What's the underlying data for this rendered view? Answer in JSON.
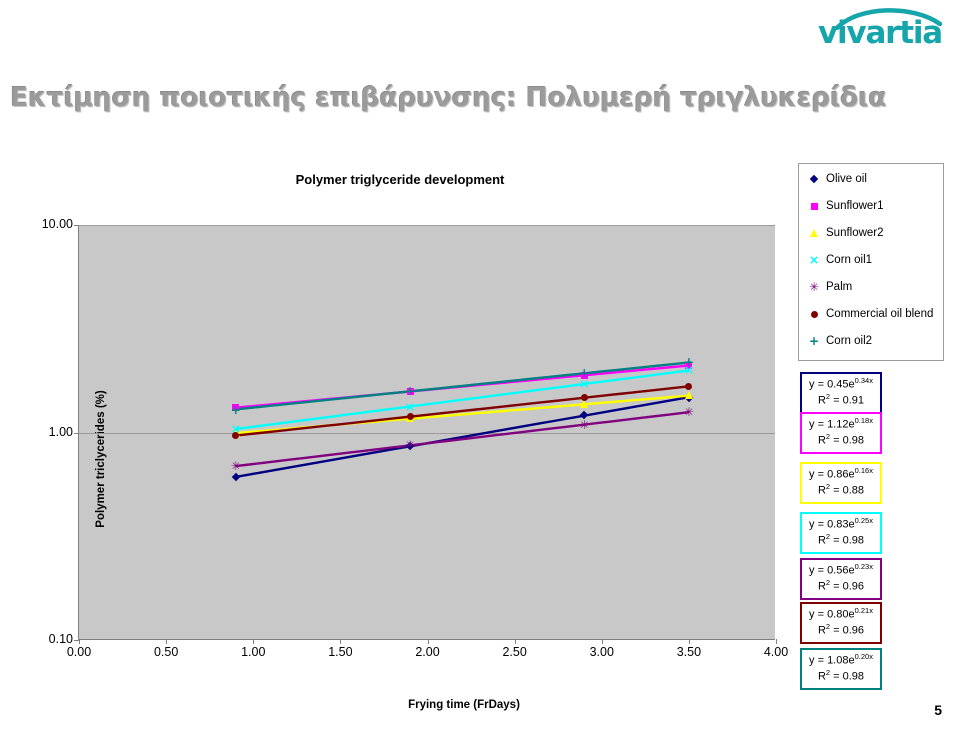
{
  "logo": {
    "text": "vivartia",
    "color": "#15a5ab"
  },
  "slide": {
    "title": "Εκτίμηση ποιοτικής επιβάρυνσης: Πολυμερή τριγλυκερίδια",
    "page_number": "5"
  },
  "chart_data": {
    "type": "scatter",
    "title": "Polymer triglyceride development",
    "xlabel": "Frying time (FrDays)",
    "ylabel": "Polymer triclycerides (%)",
    "xlim": [
      0.0,
      4.0
    ],
    "ylim": [
      0.1,
      10.0
    ],
    "yscale": "log",
    "grid": true,
    "legend_position": "right",
    "xticks": [
      "0.00",
      "0.50",
      "1.00",
      "1.50",
      "2.00",
      "2.50",
      "3.00",
      "3.50",
      "4.00"
    ],
    "xtick_values": [
      0.0,
      0.5,
      1.0,
      1.5,
      2.0,
      2.5,
      3.0,
      3.5,
      4.0
    ],
    "yticks": [
      "0.10",
      "1.00",
      "10.00"
    ],
    "ytick_values": [
      0.1,
      1.0,
      10.0
    ],
    "series": [
      {
        "name": "Olive oil",
        "color": "#000080",
        "marker": "diamond",
        "equation": "y = 0.45e",
        "exponent": "0.34x",
        "r2": "R",
        "r2_value": " = 0.91",
        "a": 0.45,
        "b": 0.34,
        "r_squared": 0.91,
        "x": [
          0.9,
          1.9,
          2.9,
          3.5
        ],
        "y": [
          0.61,
          0.86,
          1.21,
          1.47
        ]
      },
      {
        "name": "Sunflower1",
        "color": "#ff00ff",
        "marker": "square",
        "equation": "y = 1.12e",
        "exponent": "0.18x",
        "r2": "R",
        "r2_value": " = 0.98",
        "a": 1.12,
        "b": 0.18,
        "r_squared": 0.98,
        "x": [
          0.9,
          1.9,
          2.9,
          3.5
        ],
        "y": [
          1.32,
          1.58,
          1.89,
          2.1
        ]
      },
      {
        "name": "Sunflower2",
        "color": "#ffff00",
        "marker": "triangle",
        "equation": "y = 0.86e",
        "exponent": "0.16x",
        "r2": "R",
        "r2_value": " = 0.88",
        "a": 0.86,
        "b": 0.16,
        "r_squared": 0.88,
        "x": [
          0.9,
          1.9,
          2.9,
          3.5
        ],
        "y": [
          0.99,
          1.17,
          1.37,
          1.51
        ]
      },
      {
        "name": "Corn oil1",
        "color": "#00ffff",
        "marker": "cross",
        "equation": "y = 0.83e",
        "exponent": "0.25x",
        "r2": "R",
        "r2_value": " = 0.98",
        "a": 0.83,
        "b": 0.25,
        "r_squared": 0.98,
        "x": [
          0.9,
          1.9,
          2.9,
          3.5
        ],
        "y": [
          1.04,
          1.33,
          1.71,
          1.99
        ]
      },
      {
        "name": "Palm",
        "color": "#800080",
        "marker": "star",
        "equation": "y = 0.56e",
        "exponent": "0.23x",
        "r2": "R",
        "r2_value": " = 0.96",
        "a": 0.56,
        "b": 0.23,
        "r_squared": 0.96,
        "x": [
          0.9,
          1.9,
          2.9,
          3.5
        ],
        "y": [
          0.69,
          0.87,
          1.09,
          1.25
        ]
      },
      {
        "name": "Commercial oil blend",
        "color": "#800000",
        "marker": "circle",
        "equation": "y = 0.80e",
        "exponent": "0.21x",
        "r2": "R",
        "r2_value": " = 0.96",
        "a": 0.8,
        "b": 0.21,
        "r_squared": 0.96,
        "x": [
          0.9,
          1.9,
          2.9,
          3.5
        ],
        "y": [
          0.97,
          1.19,
          1.47,
          1.67
        ]
      },
      {
        "name": "Corn oil2",
        "color": "#008080",
        "marker": "plus",
        "equation": "y = 1.08e",
        "exponent": "0.20x",
        "r2": "R",
        "r2_value": " = 0.98",
        "a": 1.08,
        "b": 0.2,
        "r_squared": 0.98,
        "x": [
          0.9,
          1.9,
          2.9,
          3.5
        ],
        "y": [
          1.29,
          1.58,
          1.93,
          2.19
        ]
      }
    ]
  }
}
